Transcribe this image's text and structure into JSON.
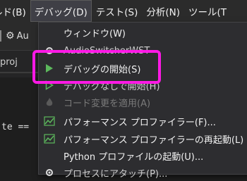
{
  "menubar": {
    "items": [
      {
        "label": "ルド(B)"
      },
      {
        "label": "デバッグ(D)"
      },
      {
        "label": "テスト(S)"
      },
      {
        "label": "分析(N)"
      },
      {
        "label": "ツール(T"
      }
    ]
  },
  "toolbar": {
    "label": "Au"
  },
  "tab": {
    "label": "proj"
  },
  "editor": {
    "code": "te =="
  },
  "menu": {
    "items": [
      {
        "label": "ウィンドウ(W)",
        "icon": "none"
      },
      {
        "label": "AudioSwitcherWST",
        "icon": "gear-icon"
      },
      {
        "label": "デバッグの開始(S)",
        "icon": "play-icon"
      },
      {
        "label": "デバッグなしで開始(H)",
        "icon": "play-outline-icon"
      },
      {
        "label": "コード変更を適用(A)",
        "icon": "flame-icon"
      },
      {
        "label": "パフォーマンス プロファイラー(F)...",
        "icon": "performance-chart-icon"
      },
      {
        "label": "パフォーマンス プロファイラーの再起動(L)",
        "icon": "performance-chart-icon"
      },
      {
        "label": "Python プロファイルの起動(U)...",
        "icon": "none"
      },
      {
        "label": "プロセスにアタッチ(P)...",
        "icon": "gear-icon"
      }
    ]
  },
  "colors": {
    "highlight": "#ff19e6",
    "play": "#5cb85c"
  }
}
